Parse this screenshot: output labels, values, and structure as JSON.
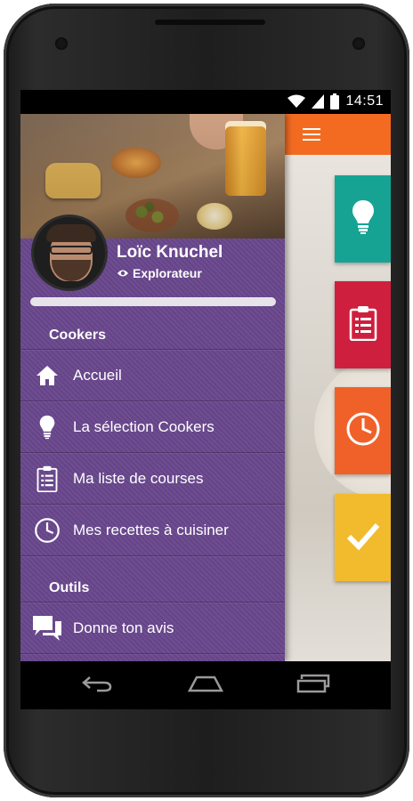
{
  "status_bar": {
    "time": "14:51",
    "icons": [
      "wifi-icon",
      "signal-icon",
      "battery-icon"
    ]
  },
  "app_bar": {
    "color": "#f36b21",
    "menu_icon": "hamburger-icon"
  },
  "background_tiles": [
    {
      "icon": "lightbulb-icon",
      "color": "#17a393"
    },
    {
      "icon": "clipboard-icon",
      "color": "#cf1f3e"
    },
    {
      "icon": "clock-icon",
      "color": "#f0612a"
    },
    {
      "icon": "checkmark-icon",
      "color": "#f2bb2d"
    }
  ],
  "drawer": {
    "background_color": "#69478d",
    "user": {
      "name": "Loïc Knuchel",
      "rank": "Explorateur",
      "rank_icon": "eye-icon",
      "progress": 0
    },
    "sections": [
      {
        "title": "Cookers",
        "items": [
          {
            "label": "Accueil",
            "icon": "home-icon"
          },
          {
            "label": "La sélection Cookers",
            "icon": "lightbulb-icon"
          },
          {
            "label": "Ma liste de courses",
            "icon": "clipboard-icon"
          },
          {
            "label": "Mes recettes à cuisiner",
            "icon": "clock-icon"
          }
        ]
      },
      {
        "title": "Outils",
        "items": [
          {
            "label": "Donne ton avis",
            "icon": "chat-icon"
          }
        ]
      }
    ]
  },
  "nav_bar": {
    "buttons": [
      "back-icon",
      "home-icon",
      "recents-icon"
    ]
  }
}
